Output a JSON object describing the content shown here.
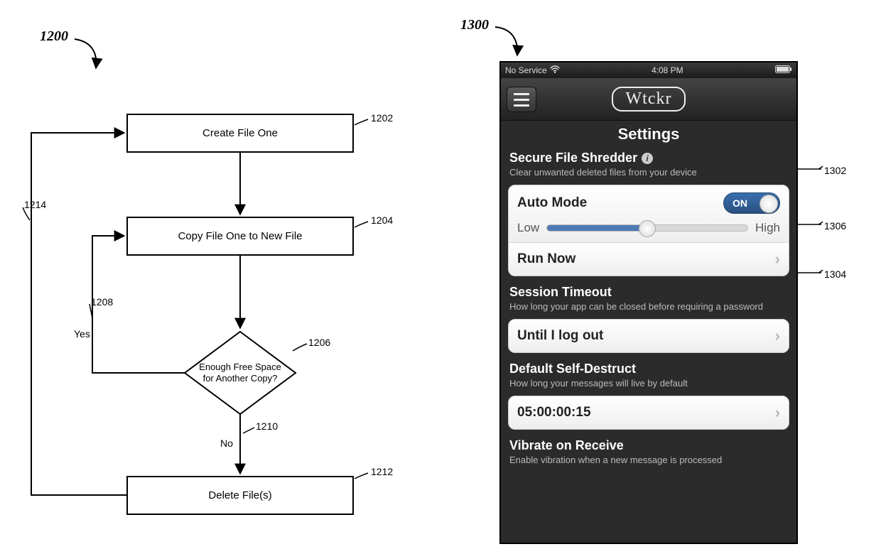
{
  "figureLeft": {
    "ref": "1200",
    "boxes": {
      "create": {
        "label": "Create File One",
        "ref": "1202"
      },
      "copy": {
        "label": "Copy File One to New File",
        "ref": "1204"
      },
      "decide": {
        "label": "Enough Free Space for Another Copy?",
        "ref": "1206"
      },
      "delete": {
        "label": "Delete File(s)",
        "ref": "1212"
      }
    },
    "edges": {
      "yes": {
        "label": "Yes",
        "ref": "1208"
      },
      "no": {
        "label": "No",
        "ref": "1210"
      },
      "loopback": {
        "ref": "1214"
      }
    }
  },
  "figureRight": {
    "ref": "1300",
    "callouts": {
      "shredder": "1302",
      "slider": "1306",
      "runNow": "1304"
    },
    "statusBar": {
      "carrier": "No Service",
      "time": "4:08 PM"
    },
    "nav": {
      "logo": "Wtckr",
      "title": "Settings"
    },
    "shredder": {
      "title": "Secure File Shredder",
      "desc": "Clear unwanted deleted files from your device",
      "autoMode": {
        "label": "Auto Mode",
        "toggleText": "ON"
      },
      "slider": {
        "low": "Low",
        "high": "High"
      },
      "runNow": "Run Now"
    },
    "session": {
      "title": "Session Timeout",
      "desc": "How long your app can be closed before requiring a password",
      "value": "Until I log out"
    },
    "selfDestruct": {
      "title": "Default Self-Destruct",
      "desc": "How long your messages will live by default",
      "value": "05:00:00:15"
    },
    "vibrate": {
      "title": "Vibrate on Receive",
      "desc": "Enable vibration when a new message is processed"
    }
  }
}
